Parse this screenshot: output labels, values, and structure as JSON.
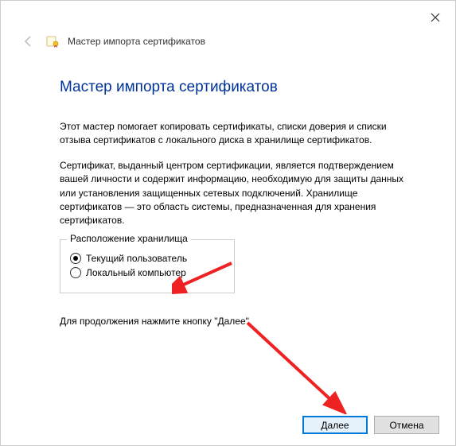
{
  "window": {
    "header_title": "Мастер импорта сертификатов"
  },
  "content": {
    "heading": "Мастер импорта сертификатов",
    "paragraph1": "Этот мастер помогает копировать сертификаты, списки доверия и списки отзыва сертификатов с локального диска в хранилище сертификатов.",
    "paragraph2": "Сертификат, выданный центром сертификации, является подтверждением вашей личности и содержит информацию, необходимую для защиты данных или установления защищенных сетевых подключений. Хранилище сертификатов — это область системы, предназначенная для хранения сертификатов.",
    "groupbox_legend": "Расположение хранилища",
    "radio_current_user": "Текущий пользователь",
    "radio_local_computer": "Локальный компьютер",
    "continue_text": "Для продолжения нажмите кнопку \"Далее\"."
  },
  "buttons": {
    "next": "Далее",
    "cancel": "Отмена"
  }
}
